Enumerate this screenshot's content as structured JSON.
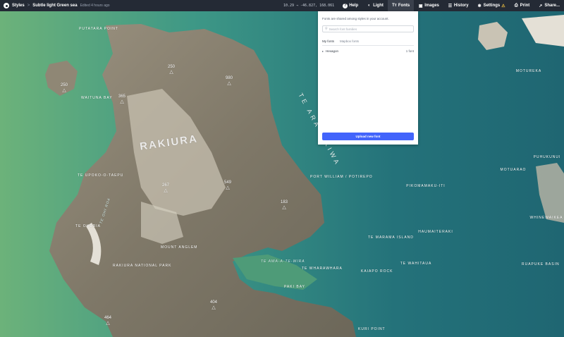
{
  "toolbar": {
    "styles_label": "Styles",
    "separator": ">",
    "style_name": "Subtle light Green sea",
    "edited_label": "Edited 4 hours ago",
    "coordinates": "10.29 → -46.827, 168.061",
    "help_label": "Help",
    "light_label": "Light",
    "fonts_label": "Fonts",
    "images_label": "Images",
    "history_label": "History",
    "settings_label": "Settings",
    "settings_warning": "⚠",
    "print_label": "Print",
    "share_label": "Share..."
  },
  "fonts_panel": {
    "note": "Fonts are shared among styles in your account.",
    "search_placeholder": "Search font families",
    "tabs": [
      {
        "label": "My fonts",
        "active": true
      },
      {
        "label": "Mapbox fonts",
        "active": false
      }
    ],
    "font_families": [
      {
        "name": "Hexagon",
        "count": "1 font"
      }
    ],
    "upload_label": "Upload new font"
  },
  "map": {
    "colors": {
      "sea_deep": "#1f6c75",
      "sea_light": "#5fb27c",
      "land": "#8c8373",
      "land_light": "#c9c3b4",
      "sand": "#e4e0d6"
    },
    "labels": [
      {
        "text": "PUTATARA POINT"
      },
      {
        "text": "WAITUNA BAY"
      },
      {
        "text": "RAKIURA"
      },
      {
        "text": "TE ARA A KIWA"
      },
      {
        "text": "TE UPOKO-O-TAEPU"
      },
      {
        "text": "TE OHI ROA"
      },
      {
        "text": "TE OHERIA"
      },
      {
        "text": "PORT WILLIAM / POTIREPO"
      },
      {
        "text": "MOUNT ANGLEM"
      },
      {
        "text": "RAKIURA NATIONAL PARK"
      },
      {
        "text": "TE AWA-A-TE-WIRA"
      },
      {
        "text": "TE WHARAWHARA"
      },
      {
        "text": "PAKI BAY"
      },
      {
        "text": "PIKOMAMAKU-ITI"
      },
      {
        "text": "HAUMAITERAKI"
      },
      {
        "text": "TE MARAMA ISLAND"
      },
      {
        "text": "KAIAPO ROCK"
      },
      {
        "text": "TE WAHITAUA"
      },
      {
        "text": "MOTUREKA"
      },
      {
        "text": "PUHUKUNUI"
      },
      {
        "text": "MOTUARAO"
      },
      {
        "text": "WHINEWAIKEA"
      },
      {
        "text": "RUAPUKE BASIN"
      },
      {
        "text": "KURI POINT"
      }
    ],
    "peaks": [
      {
        "elevation": "250"
      },
      {
        "elevation": "250"
      },
      {
        "elevation": "980"
      },
      {
        "elevation": "365"
      },
      {
        "elevation": "267"
      },
      {
        "elevation": "549"
      },
      {
        "elevation": "183"
      },
      {
        "elevation": "404"
      },
      {
        "elevation": "464"
      }
    ]
  }
}
